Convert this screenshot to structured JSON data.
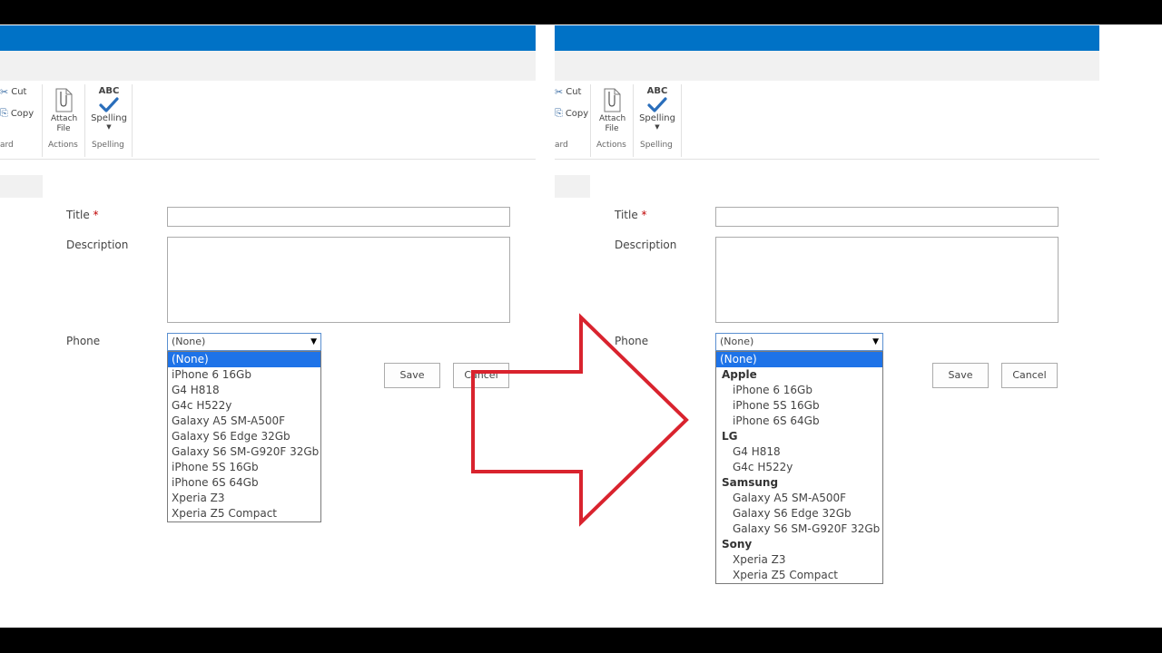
{
  "colors": {
    "suite_bar": "#0072c6",
    "selected_option": "#1e73e8",
    "arrow": "#d9232e"
  },
  "ribbon": {
    "cut_label": "Cut",
    "copy_label": "Copy",
    "clipboard_label_partial": "ard",
    "attach_line1": "Attach",
    "attach_line2": "File",
    "actions_label": "Actions",
    "spelling_abc": "ABC",
    "spelling_button_label": "Spelling",
    "spelling_group_label": "Spelling"
  },
  "form": {
    "title_label": "Title",
    "required_marker": "*",
    "description_label": "Description",
    "phone_label": "Phone",
    "phone_selected": "(None)",
    "save_label": "Save",
    "cancel_label": "Cancel"
  },
  "before_dropdown": {
    "options": [
      "(None)",
      "iPhone 6 16Gb",
      "G4 H818",
      "G4c H522y",
      "Galaxy A5 SM-A500F",
      "Galaxy S6 Edge 32Gb",
      "Galaxy S6 SM-G920F 32Gb",
      "iPhone 5S 16Gb",
      "iPhone 6S 64Gb",
      "Xperia Z3",
      "Xperia Z5 Compact"
    ]
  },
  "after_dropdown": {
    "none_option": "(None)",
    "groups": [
      {
        "name": "Apple",
        "options": [
          "iPhone 6 16Gb",
          "iPhone 5S 16Gb",
          "iPhone 6S 64Gb"
        ]
      },
      {
        "name": "LG",
        "options": [
          "G4 H818",
          "G4c H522y"
        ]
      },
      {
        "name": "Samsung",
        "options": [
          "Galaxy A5 SM-A500F",
          "Galaxy S6 Edge 32Gb",
          "Galaxy S6 SM-G920F 32Gb"
        ]
      },
      {
        "name": "Sony",
        "options": [
          "Xperia Z3",
          "Xperia Z5 Compact"
        ]
      }
    ]
  }
}
